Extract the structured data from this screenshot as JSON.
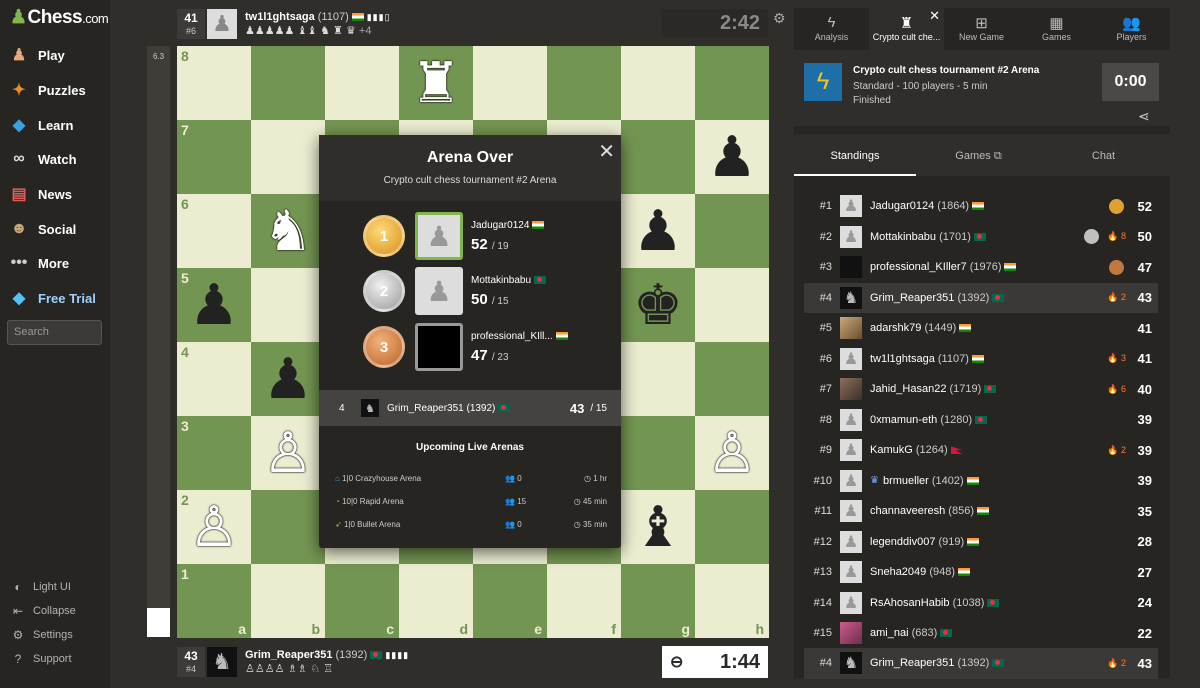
{
  "logo": {
    "text": "Chess",
    "domain": ".com"
  },
  "nav": [
    {
      "label": "Play",
      "icon": "play-icon"
    },
    {
      "label": "Puzzles",
      "icon": "puzzle-icon"
    },
    {
      "label": "Learn",
      "icon": "learn-icon"
    },
    {
      "label": "Watch",
      "icon": "binoculars-icon"
    },
    {
      "label": "News",
      "icon": "news-icon"
    },
    {
      "label": "Social",
      "icon": "social-icon"
    },
    {
      "label": "More",
      "icon": "more-icon"
    },
    {
      "label": "Free Trial",
      "icon": "diamond-icon"
    }
  ],
  "search_placeholder": "Search",
  "bottom_nav": [
    "Light UI",
    "Collapse",
    "Settings",
    "Support"
  ],
  "eval": "6.3",
  "top_player": {
    "rank": "41",
    "rank_sub": "#6",
    "name": "tw1l1ghtsaga",
    "rating": "(1107)",
    "captured": "♟♟♟♟♟ ♝♝ ♞ ♜ ♛",
    "diff": "+4",
    "clock": "2:42"
  },
  "bottom_player": {
    "rank": "43",
    "rank_sub": "#4",
    "name": "Grim_Reaper351",
    "rating": "(1392)",
    "captured": "♙♙♙♙ ♗♗ ♘ ♖",
    "clock": "1:44"
  },
  "board": {
    "ranks": [
      "8",
      "7",
      "6",
      "5",
      "4",
      "3",
      "2",
      "1"
    ],
    "files": [
      "a",
      "b",
      "c",
      "d",
      "e",
      "f",
      "g",
      "h"
    ],
    "pieces": {
      "d8": "♜w",
      "h7": "♟b",
      "b6": "♞w",
      "g6": "♟b",
      "a5": "♟b",
      "g5": "♚b",
      "b4": "♟b",
      "b3": "♙w",
      "h3": "♙w",
      "a2": "♙w",
      "g2": "♝b"
    }
  },
  "modal": {
    "title": "Arena Over",
    "subtitle": "Crypto cult chess tournament #2 Arena",
    "podium": [
      {
        "medal": "1",
        "name": "Jadugar0124",
        "score": "52",
        "games": "/ 19"
      },
      {
        "medal": "2",
        "name": "Mottakinbabu",
        "score": "50",
        "games": "/ 15"
      },
      {
        "medal": "3",
        "name": "professional_KIll...",
        "score": "47",
        "games": "/ 23"
      }
    ],
    "self": {
      "rank": "4",
      "name": "Grim_Reaper351 (1392)",
      "score": "43",
      "games": "/ 15"
    },
    "upcoming_title": "Upcoming Live Arenas",
    "upcoming": [
      {
        "name": "1|0 Crazyhouse Arena",
        "players": "0",
        "time": "1 hr"
      },
      {
        "name": "10|0 Rapid Arena",
        "players": "15",
        "time": "45 min"
      },
      {
        "name": "1|0 Bullet Arena",
        "players": "0",
        "time": "35 min"
      }
    ]
  },
  "tabs": [
    {
      "label": "Analysis",
      "icon": "analysis-icon"
    },
    {
      "label": "Crypto cult che...",
      "icon": "tournament-icon"
    },
    {
      "label": "New Game",
      "icon": "plus-icon"
    },
    {
      "label": "Games",
      "icon": "board-icon"
    },
    {
      "label": "Players",
      "icon": "players-icon"
    }
  ],
  "tournament": {
    "title": "Crypto cult chess tournament #2 Arena",
    "line1": "Standard - 100 players - 5 min",
    "line2": "Finished",
    "clock": "0:00"
  },
  "subtabs": [
    "Standings",
    "Games",
    "Chat"
  ],
  "standings": [
    {
      "rank": "#1",
      "name": "Jadugar0124",
      "rating": "(1864)",
      "flag": "in",
      "medal": "gold",
      "streak": "",
      "points": "52"
    },
    {
      "rank": "#2",
      "name": "Mottakinbabu",
      "rating": "(1701)",
      "flag": "bd",
      "medal": "silver",
      "streak": "8",
      "points": "50"
    },
    {
      "rank": "#3",
      "name": "professional_KIller7",
      "rating": "(1976)",
      "flag": "in",
      "medal": "bronze",
      "streak": "",
      "points": "47"
    },
    {
      "rank": "#4",
      "name": "Grim_Reaper351",
      "rating": "(1392)",
      "flag": "bd",
      "medal": "",
      "streak": "2",
      "points": "43",
      "me": true
    },
    {
      "rank": "#5",
      "name": "adarshk79",
      "rating": "(1449)",
      "flag": "in",
      "medal": "",
      "streak": "",
      "points": "41"
    },
    {
      "rank": "#6",
      "name": "tw1l1ghtsaga",
      "rating": "(1107)",
      "flag": "in",
      "medal": "",
      "streak": "3",
      "points": "41"
    },
    {
      "rank": "#7",
      "name": "Jahid_Hasan22",
      "rating": "(1719)",
      "flag": "bd",
      "medal": "",
      "streak": "6",
      "points": "40"
    },
    {
      "rank": "#8",
      "name": "0xmamun-eth",
      "rating": "(1280)",
      "flag": "bd",
      "medal": "",
      "streak": "",
      "points": "39"
    },
    {
      "rank": "#9",
      "name": "KamukG",
      "rating": "(1264)",
      "flag": "np",
      "medal": "",
      "streak": "2",
      "points": "39"
    },
    {
      "rank": "#10",
      "name": "brmueller",
      "rating": "(1402)",
      "flag": "in",
      "medal": "",
      "streak": "",
      "points": "39",
      "crown": true
    },
    {
      "rank": "#11",
      "name": "channaveeresh",
      "rating": "(856)",
      "flag": "in",
      "medal": "",
      "streak": "",
      "points": "35"
    },
    {
      "rank": "#12",
      "name": "legenddiv007",
      "rating": "(919)",
      "flag": "in",
      "medal": "",
      "streak": "",
      "points": "28"
    },
    {
      "rank": "#13",
      "name": "Sneha2049",
      "rating": "(948)",
      "flag": "in",
      "medal": "",
      "streak": "",
      "points": "27"
    },
    {
      "rank": "#14",
      "name": "RsAhosanHabib",
      "rating": "(1038)",
      "flag": "bd",
      "medal": "",
      "streak": "",
      "points": "24"
    },
    {
      "rank": "#15",
      "name": "ami_nai",
      "rating": "(683)",
      "flag": "bd",
      "medal": "",
      "streak": "",
      "points": "22"
    }
  ],
  "footer_self": {
    "rank": "#4",
    "name": "Grim_Reaper351",
    "rating": "(1392)",
    "streak": "2",
    "points": "43"
  }
}
